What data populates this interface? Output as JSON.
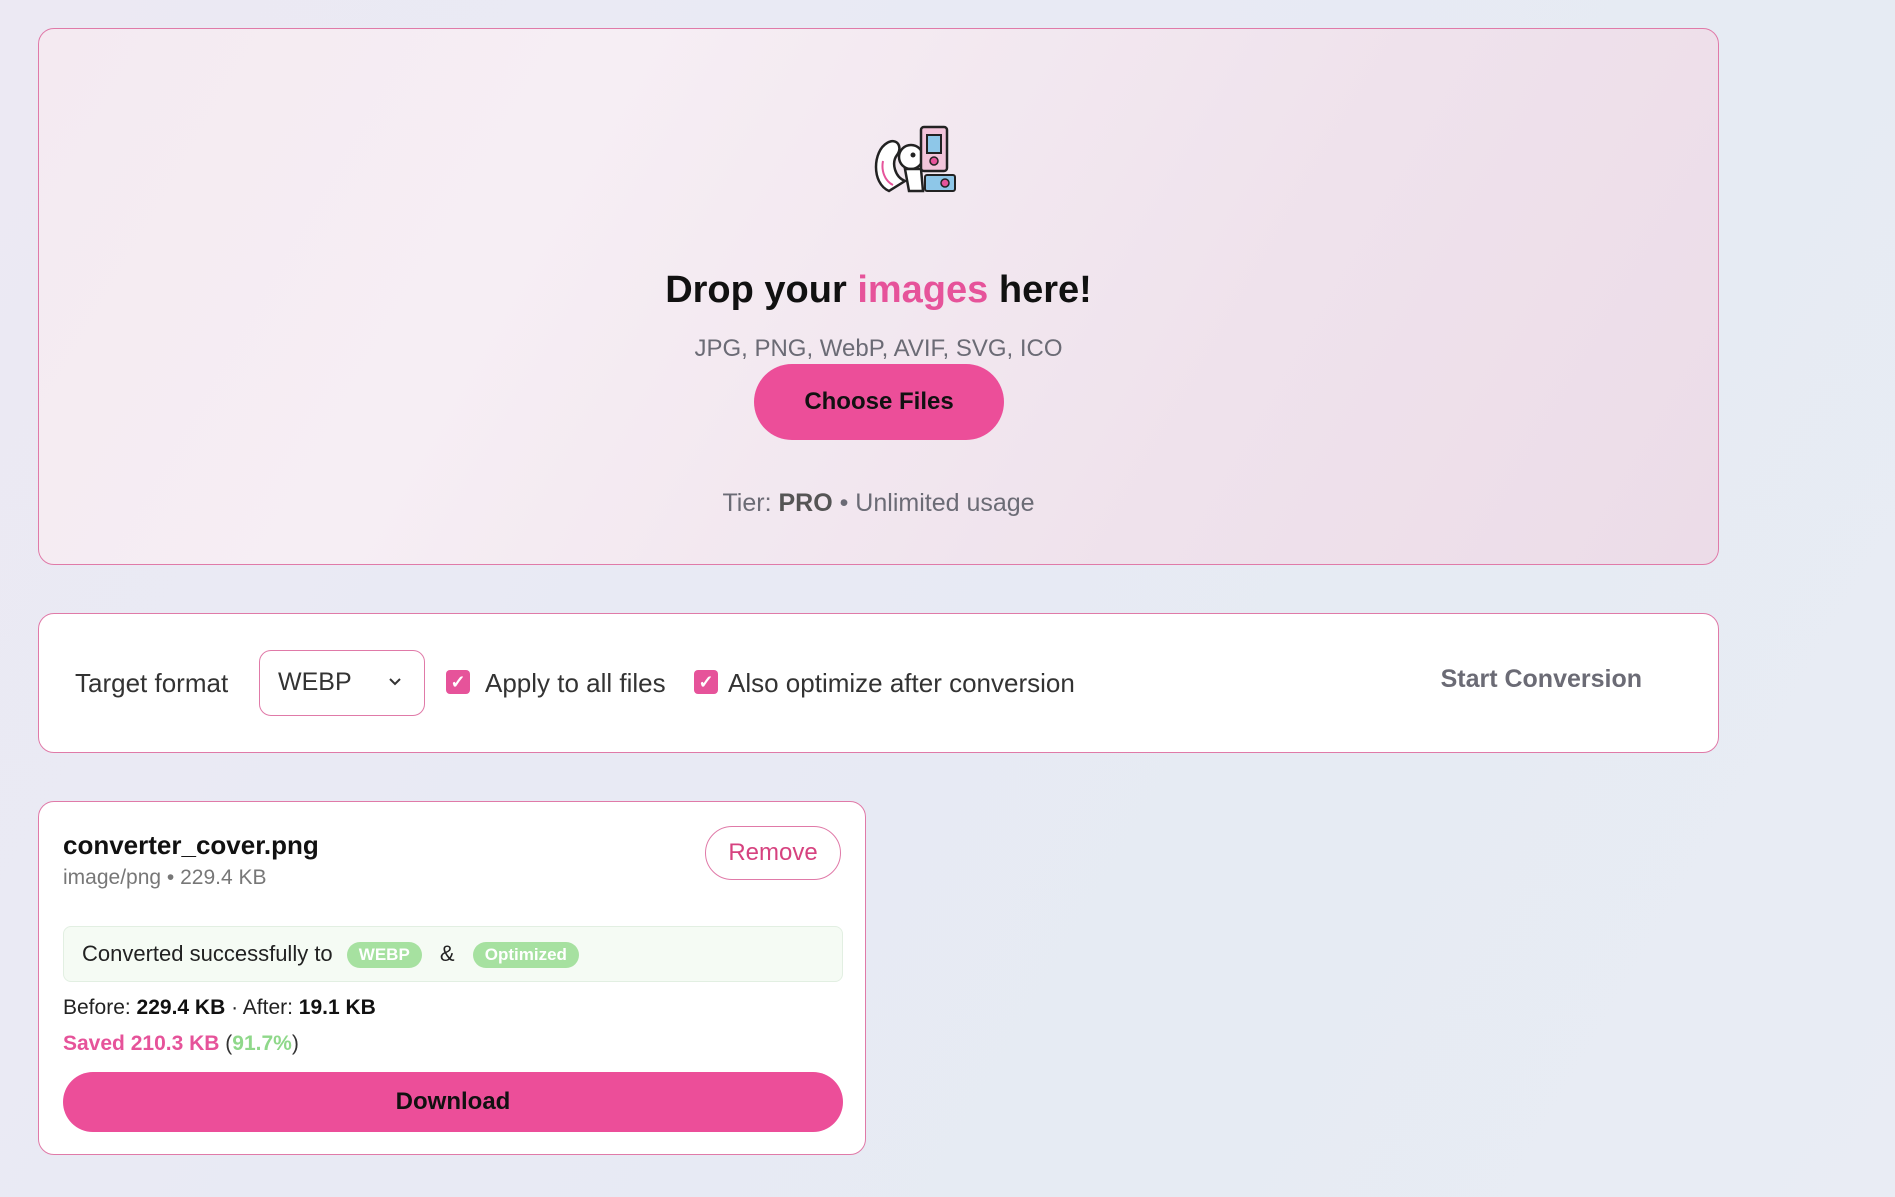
{
  "dropzone": {
    "title_before": "Drop your ",
    "title_accent": "images",
    "title_after": " here!",
    "formats": "JPG, PNG, WebP, AVIF, SVG, ICO",
    "choose_label": "Choose Files",
    "tier_prefix": "Tier: ",
    "tier_name": "PRO",
    "tier_suffix": " • Unlimited usage",
    "mascot_icon": "squirrel-camera-icon"
  },
  "options": {
    "target_label": "Target format",
    "format_selected": "WEBP",
    "apply_all_label": "Apply to all files",
    "apply_all_checked": true,
    "optimize_label": "Also optimize after conversion",
    "optimize_checked": true,
    "start_label": "Start Conversion"
  },
  "file": {
    "name": "converter_cover.png",
    "meta": "image/png • 229.4 KB",
    "remove_label": "Remove",
    "status_text": "Converted successfully to",
    "format_badge": "WEBP",
    "amp": "&",
    "optimized_badge": "Optimized",
    "before_label": "Before: ",
    "before_value": "229.4 KB",
    "after_label": " · After: ",
    "after_value": "19.1 KB",
    "saved_text": "Saved 210.3 KB",
    "saved_pct": "91.7%",
    "download_label": "Download"
  },
  "colors": {
    "accent": "#ec4e99",
    "border": "#e07aa8",
    "success": "#a6e1a0"
  }
}
